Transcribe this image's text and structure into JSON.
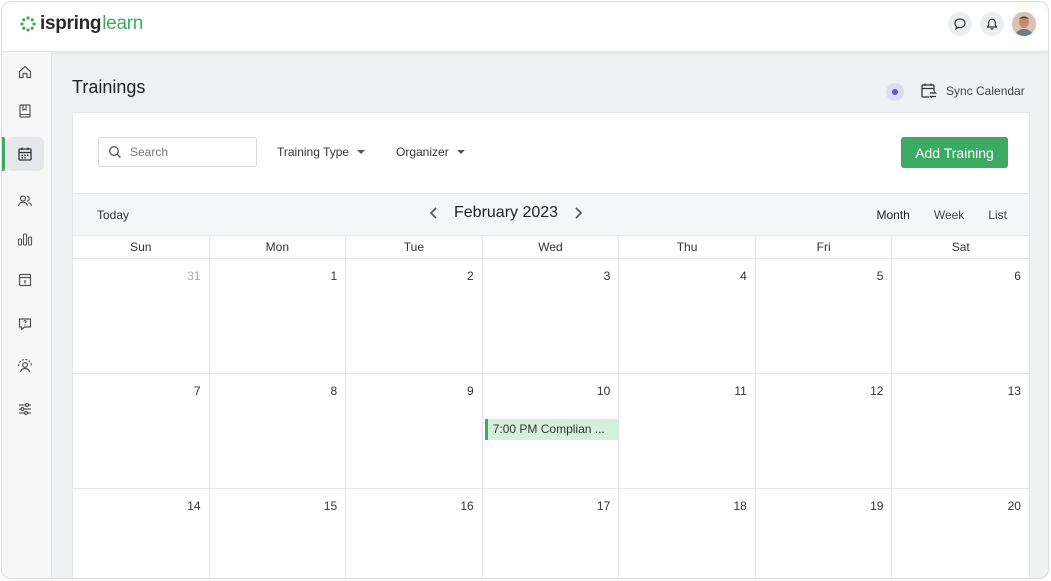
{
  "header": {
    "logo_ispring": "ispring",
    "logo_learn": "learn",
    "brand_color": "#3daa63",
    "icons": [
      "chat-icon",
      "bell-icon",
      "user-avatar"
    ]
  },
  "sidebar": {
    "items": [
      {
        "name": "home",
        "icon": "home-icon",
        "active": false
      },
      {
        "name": "content",
        "icon": "book-icon",
        "active": false
      },
      {
        "name": "trainings",
        "icon": "calendar-icon",
        "active": true
      },
      {
        "name": "users",
        "icon": "users-icon",
        "active": false
      },
      {
        "name": "reports",
        "icon": "bar-chart-icon",
        "active": false
      },
      {
        "name": "info",
        "icon": "info-box-icon",
        "active": false
      },
      {
        "name": "questions",
        "icon": "question-chat-icon",
        "active": false
      },
      {
        "name": "support",
        "icon": "headset-icon",
        "active": false
      },
      {
        "name": "settings",
        "icon": "sliders-icon",
        "active": false
      }
    ]
  },
  "page": {
    "title": "Trainings",
    "sync_label": "Sync Calendar"
  },
  "filters": {
    "search_placeholder": "Search",
    "training_type": "Training Type",
    "organizer": "Organizer",
    "add_button": "Add Training"
  },
  "calendar": {
    "today_label": "Today",
    "month_label": "February 2023",
    "views": [
      "Month",
      "Week",
      "List"
    ],
    "current_view": "Month",
    "weekdays": [
      "Sun",
      "Mon",
      "Tue",
      "Wed",
      "Thu",
      "Fri",
      "Sat"
    ],
    "weeks": [
      [
        {
          "d": "31",
          "muted": true
        },
        {
          "d": "1"
        },
        {
          "d": "2"
        },
        {
          "d": "3"
        },
        {
          "d": "4"
        },
        {
          "d": "5"
        },
        {
          "d": "6"
        }
      ],
      [
        {
          "d": "7"
        },
        {
          "d": "8"
        },
        {
          "d": "9"
        },
        {
          "d": "10",
          "event": "7:00 PM Complian ..."
        },
        {
          "d": "11"
        },
        {
          "d": "12"
        },
        {
          "d": "13"
        }
      ],
      [
        {
          "d": "14"
        },
        {
          "d": "15"
        },
        {
          "d": "16"
        },
        {
          "d": "17"
        },
        {
          "d": "18"
        },
        {
          "d": "19"
        },
        {
          "d": "20"
        }
      ]
    ]
  }
}
